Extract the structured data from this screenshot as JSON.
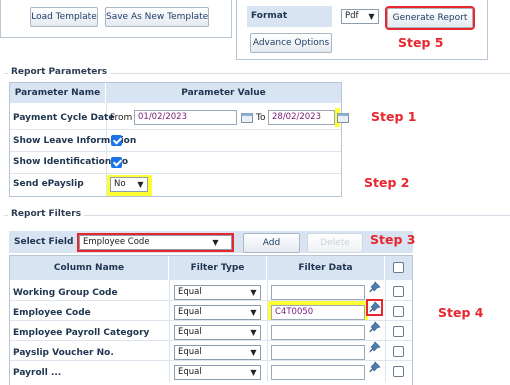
{
  "template_buttons": {
    "load_template": "Load Template",
    "save_as_new_template": "Save As New Template"
  },
  "format_panel": {
    "label": "Format",
    "value": "Pdf",
    "generate_report": "Generate Report",
    "advance_options": "Advance Options"
  },
  "steps": {
    "step1": "Step 1",
    "step2": "Step 2",
    "step3": "Step 3",
    "step4": "Step 4",
    "step5": "Step 5"
  },
  "report_parameters": {
    "legend": "Report Parameters",
    "header_name": "Parameter Name",
    "header_value": "Parameter Value",
    "rows": [
      {
        "label": "Payment Cycle Date",
        "from_label": "From",
        "from_value": "01/02/2023",
        "to_label": "To",
        "to_value": "28/02/2023"
      },
      {
        "label": "Show Leave Information",
        "checked": true
      },
      {
        "label": "Show Identification No",
        "checked": true
      },
      {
        "label": "Send ePayslip",
        "value": "No"
      }
    ]
  },
  "report_filters": {
    "legend": "Report Filters",
    "select_field_label": "Select Field",
    "select_field_value": "Employee Code",
    "add": "Add",
    "delete": "Delete",
    "columns": [
      "Column Name",
      "Filter Type",
      "Filter Data"
    ],
    "rows": [
      {
        "name": "Working Group Code",
        "type": "Equal",
        "data": ""
      },
      {
        "name": "Employee Code",
        "type": "Equal",
        "data": "C4T0050"
      },
      {
        "name": "Employee Payroll Category",
        "type": "Equal",
        "data": ""
      },
      {
        "name": "Payslip Voucher No.",
        "type": "Equal",
        "data": ""
      },
      {
        "name": "Payroll ...",
        "type": "Equal",
        "data": ""
      }
    ]
  },
  "colors": {
    "highlight": "#ffff33",
    "step_red": "#e8262e",
    "header_blue": "#d8e4f2"
  }
}
